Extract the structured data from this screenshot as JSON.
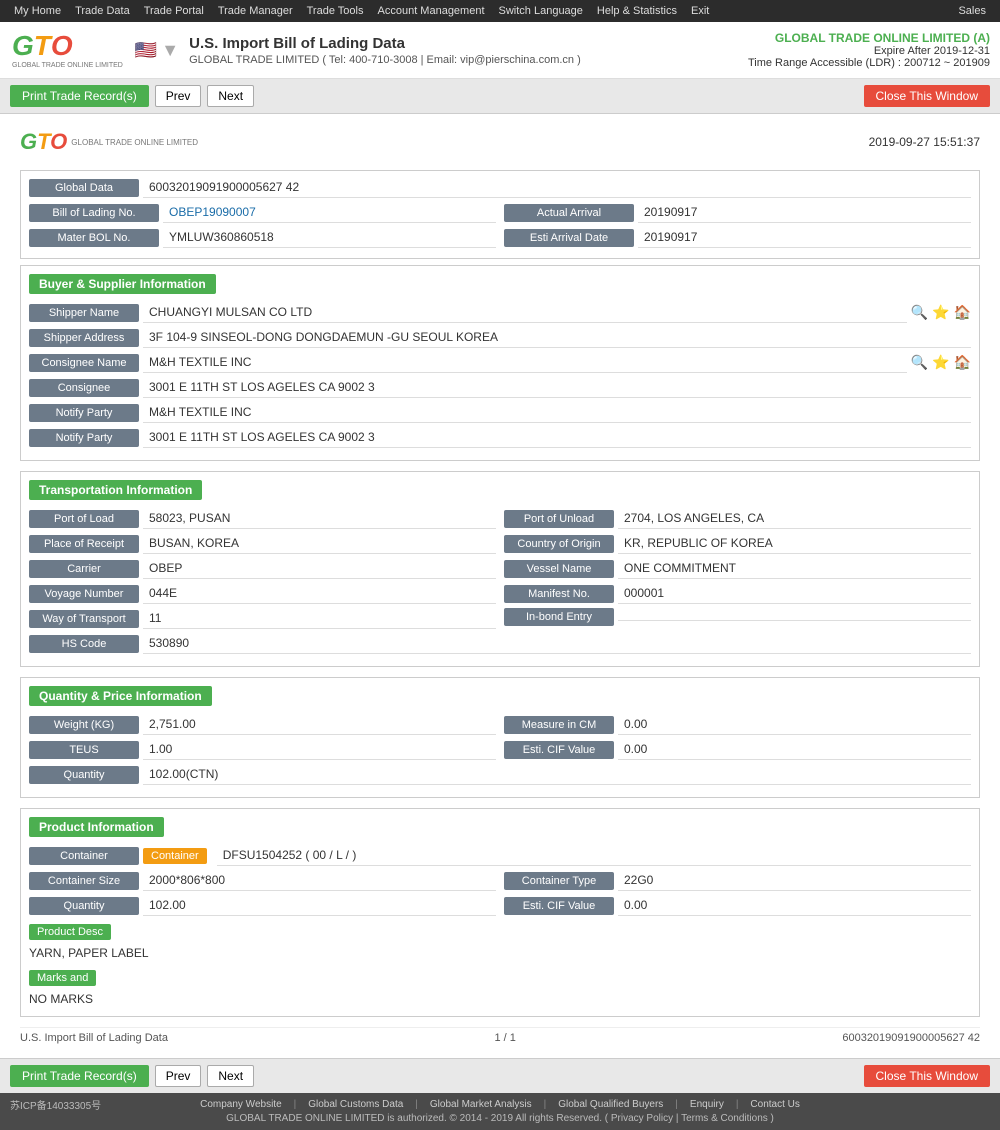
{
  "topnav": {
    "items": [
      "My Home",
      "Trade Data",
      "Trade Portal",
      "Trade Manager",
      "Trade Tools",
      "Account Management",
      "Switch Language",
      "Help & Statistics",
      "Exit"
    ],
    "sales": "Sales"
  },
  "header": {
    "logo_letters": "GTO",
    "logo_sub": "GLOBAL TRADE ONLINE LIMITED",
    "flag_emoji": "🇺🇸",
    "title": "U.S. Import Bill of Lading Data",
    "subtitle": "GLOBAL TRADE LIMITED ( Tel: 400-710-3008 | Email: vip@pierschina.com.cn )",
    "company": "GLOBAL TRADE ONLINE LIMITED (A)",
    "expire": "Expire After 2019-12-31",
    "ldr": "Time Range Accessible (LDR) : 200712 ~ 201909"
  },
  "toolbar": {
    "print_btn": "Print Trade Record(s)",
    "prev_btn": "Prev",
    "next_btn": "Next",
    "close_btn": "Close This Window"
  },
  "document": {
    "timestamp": "2019-09-27 15:51:37",
    "global_data_label": "Global Data",
    "global_data_value": "60032019091900005627 42",
    "bol_label": "Bill of Lading No.",
    "bol_value": "OBEP19090007",
    "actual_arrival_label": "Actual Arrival",
    "actual_arrival_value": "20190917",
    "master_bol_label": "Mater BOL No.",
    "master_bol_value": "YMLUW360860518",
    "esti_arrival_label": "Esti Arrival Date",
    "esti_arrival_value": "20190917",
    "buyer_supplier_title": "Buyer & Supplier Information",
    "shipper_name_label": "Shipper Name",
    "shipper_name_value": "CHUANGYI MULSAN CO LTD",
    "shipper_address_label": "Shipper Address",
    "shipper_address_value": "3F 104-9 SINSEOL-DONG DONGDAEMUN -GU SEOUL KOREA",
    "consignee_name_label": "Consignee Name",
    "consignee_name_value": "M&H TEXTILE INC",
    "consignee_label": "Consignee",
    "consignee_value": "3001 E 11TH ST LOS AGELES CA 9002 3",
    "notify_party_label": "Notify Party",
    "notify_party_value": "M&H TEXTILE INC",
    "notify_party2_value": "3001 E 11TH ST LOS AGELES CA 9002 3",
    "transport_title": "Transportation Information",
    "port_load_label": "Port of Load",
    "port_load_value": "58023, PUSAN",
    "port_unload_label": "Port of Unload",
    "port_unload_value": "2704, LOS ANGELES, CA",
    "place_receipt_label": "Place of Receipt",
    "place_receipt_value": "BUSAN, KOREA",
    "country_origin_label": "Country of Origin",
    "country_origin_value": "KR, REPUBLIC OF KOREA",
    "carrier_label": "Carrier",
    "carrier_value": "OBEP",
    "vessel_name_label": "Vessel Name",
    "vessel_name_value": "ONE COMMITMENT",
    "voyage_label": "Voyage Number",
    "voyage_value": "044E",
    "manifest_label": "Manifest No.",
    "manifest_value": "000001",
    "way_transport_label": "Way of Transport",
    "way_transport_value": "11",
    "inbond_label": "In-bond Entry",
    "inbond_value": "",
    "hs_code_label": "HS Code",
    "hs_code_value": "530890",
    "quantity_title": "Quantity & Price Information",
    "weight_label": "Weight (KG)",
    "weight_value": "2,751.00",
    "measure_label": "Measure in CM",
    "measure_value": "0.00",
    "teus_label": "TEUS",
    "teus_value": "1.00",
    "esti_cif_label": "Esti. CIF Value",
    "esti_cif_value": "0.00",
    "quantity_label": "Quantity",
    "quantity_value": "102.00(CTN)",
    "product_title": "Product Information",
    "container_label": "Container",
    "container_value": "DFSU1504252 ( 00 / L / )",
    "container_size_label": "Container Size",
    "container_size_value": "2000*806*800",
    "container_type_label": "Container Type",
    "container_type_value": "22G0",
    "product_quantity_label": "Quantity",
    "product_quantity_value": "102.00",
    "product_esti_cif_label": "Esti. CIF Value",
    "product_esti_cif_value": "0.00",
    "product_desc_label": "Product Desc",
    "product_desc_value": "YARN, PAPER LABEL",
    "marks_label": "Marks and",
    "marks_value": "NO MARKS",
    "doc_footer_left": "U.S. Import Bill of Lading Data",
    "doc_footer_page": "1 / 1",
    "doc_footer_right": "60032019091900005627 42"
  },
  "footer": {
    "print_btn": "Print Trade Record(s)",
    "prev_btn": "Prev",
    "next_btn": "Next",
    "close_btn": "Close This Window",
    "icp": "苏ICP备14033305号",
    "links": [
      "Company Website",
      "Global Customs Data",
      "Global Market Analysis",
      "Global Qualified Buyers",
      "Enquiry",
      "Contact Us"
    ],
    "copyright": "GLOBAL TRADE ONLINE LIMITED is authorized. © 2014 - 2019 All rights Reserved. ( Privacy Policy | Terms & Conditions )"
  }
}
